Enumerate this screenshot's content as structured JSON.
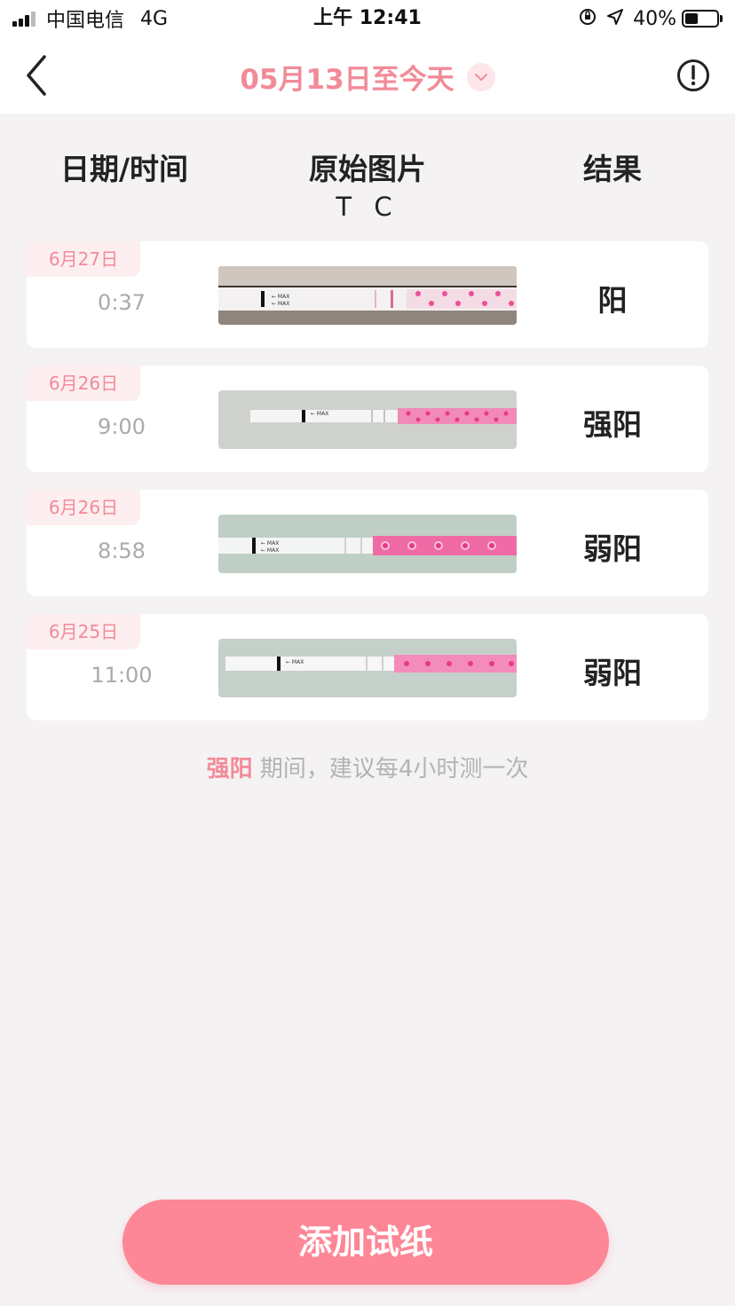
{
  "status_bar": {
    "carrier": "中国电信",
    "network": "4G",
    "time": "上午 12:41",
    "battery": "40%",
    "battery_level": 0.4
  },
  "header": {
    "title": "05月13日至今天",
    "back_icon": "chevron-left-icon",
    "dropdown_icon": "chevron-down-icon",
    "info_icon": "exclamation-circle-icon"
  },
  "columns": {
    "date_time": "日期/时间",
    "original_image": "原始图片",
    "tc": "T C",
    "result": "结果"
  },
  "records": [
    {
      "date": "6月27日",
      "time": "0:37",
      "result": "阳"
    },
    {
      "date": "6月26日",
      "time": "9:00",
      "result": "强阳"
    },
    {
      "date": "6月26日",
      "time": "8:58",
      "result": "弱阳"
    },
    {
      "date": "6月25日",
      "time": "11:00",
      "result": "弱阳"
    }
  ],
  "hint": {
    "highlight": "强阳",
    "text": " 期间，建议每4小时测一次"
  },
  "add_button": {
    "label": "添加试纸"
  },
  "colors": {
    "accent": "#f28b98",
    "button": "#fd8796",
    "background": "#f5f2f4",
    "strip_pink": "#e8388a"
  }
}
